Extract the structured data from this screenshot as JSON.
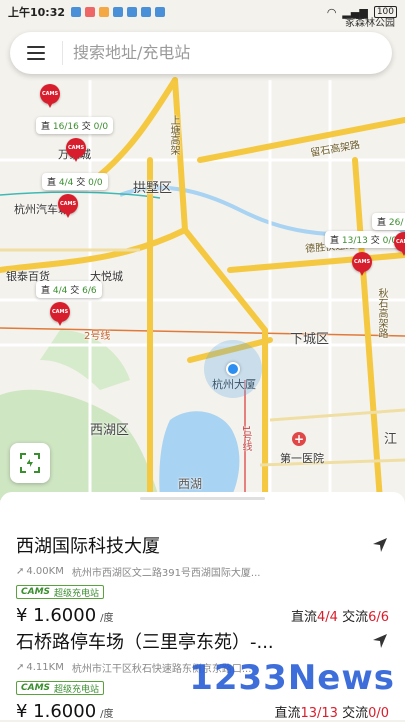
{
  "status_bar": {
    "time": "上午10:32",
    "battery": "100",
    "park_label": "冢森林公园"
  },
  "search": {
    "placeholder": "搜索地址/充电站"
  },
  "map_labels": {
    "gongshu": "拱墅区",
    "xiacheng": "下城区",
    "xihu_district": "西湖区",
    "xihu": "西湖",
    "shangtang": "上塘高架",
    "liushi": "留石高架路",
    "deshengkuai": "德胜快速路",
    "qiushi": "秋石高架路",
    "line2": "2号线",
    "line1": "1号线",
    "wanxiang": "万象城",
    "hangzhou_auto": "杭州汽车城",
    "yintai": "银泰百货",
    "dayue": "大悦城",
    "hangzhou_dasha": "杭州大厦",
    "first_hospital": "第一医院",
    "jiang": "江"
  },
  "stations": [
    {
      "zhi": "16/16",
      "jiao": "0/0"
    },
    {
      "zhi": "4/4",
      "jiao": "0/0"
    },
    {
      "zhi": "4/4",
      "jiao": "6/6"
    },
    {
      "zhi": "13/13",
      "jiao": "0/0"
    },
    {
      "zhi": "26/",
      "jiao": ""
    }
  ],
  "station_labels": {
    "zhi": "直",
    "jiao": "交"
  },
  "list": [
    {
      "name": "西湖国际科技大厦",
      "distance": "4.00KM",
      "address": "杭州市西湖区文二路391号西湖国际大厦...",
      "badge_logo": "CAMS",
      "badge_text": "超级充电站",
      "price": "¥ 1.6000",
      "unit": "/度",
      "zhi_label": "直流",
      "zhi": "4/4",
      "jiao_label": "交流",
      "jiao": "6/6"
    },
    {
      "name": "石桥路停车场（三里亭东苑）-...",
      "distance": "4.11KM",
      "address": "杭州市江干区秋石快速路东侧京东路口...",
      "badge_logo": "CAMS",
      "badge_text": "超级充电站",
      "price": "¥ 1.6000",
      "unit": "/度",
      "zhi_label": "直流",
      "zhi": "13/13",
      "jiao_label": "交流",
      "jiao": "0/0"
    }
  ],
  "watermark": "1233News",
  "colors": {
    "accent_red": "#d81e2c",
    "accent_green": "#3b8e2f",
    "road_yellow": "#f5c842",
    "location_blue": "#2b8ef0"
  }
}
